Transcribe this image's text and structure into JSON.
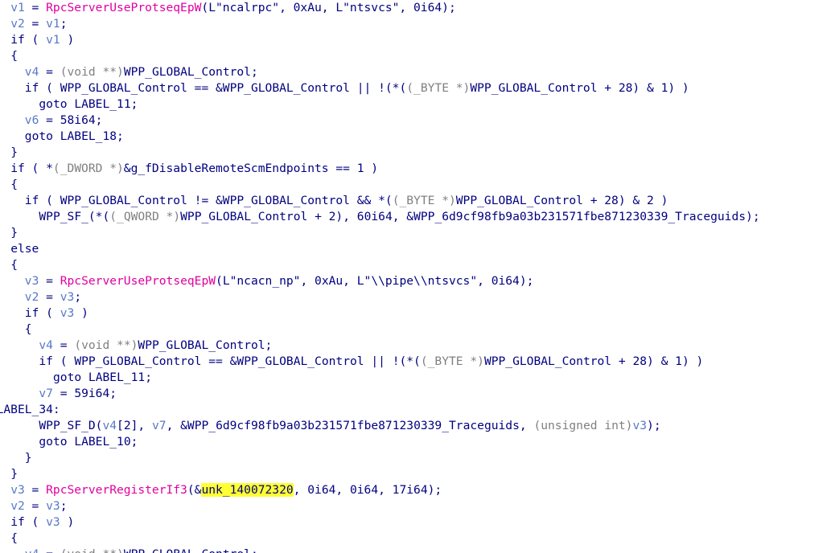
{
  "colors": {
    "default": "#000080",
    "var": "#5878c8",
    "func": "#e000a0",
    "cast": "#808080",
    "highlight": "#ffff33",
    "background": "#ffffff"
  },
  "lines": [
    {
      "indent": 1.5,
      "tokens": [
        [
          "v1",
          "var"
        ],
        [
          " = ",
          "default"
        ],
        [
          "RpcServerUseProtseqEpW",
          "func"
        ],
        [
          "(L\"ncalrpc\", 0xAu, L\"ntsvcs\", 0i64);",
          "default"
        ]
      ]
    },
    {
      "indent": 1.5,
      "tokens": [
        [
          "v2",
          "var"
        ],
        [
          " = ",
          "default"
        ],
        [
          "v1",
          "var"
        ],
        [
          ";",
          "default"
        ]
      ]
    },
    {
      "indent": 1.5,
      "tokens": [
        [
          "if ( ",
          "default"
        ],
        [
          "v1",
          "var"
        ],
        [
          " )",
          "default"
        ]
      ]
    },
    {
      "indent": 1.5,
      "tokens": [
        [
          "{",
          "default"
        ]
      ]
    },
    {
      "indent": 3.5,
      "tokens": [
        [
          "v4",
          "var"
        ],
        [
          " = ",
          "default"
        ],
        [
          "(void **)",
          "cast"
        ],
        [
          "WPP_GLOBAL_Control;",
          "default"
        ]
      ]
    },
    {
      "indent": 3.5,
      "tokens": [
        [
          "if ( WPP_GLOBAL_Control == &WPP_GLOBAL_Control || !(*(",
          "default"
        ],
        [
          "(_BYTE *)",
          "cast"
        ],
        [
          "WPP_GLOBAL_Control + 28) & 1) )",
          "default"
        ]
      ]
    },
    {
      "indent": 5.5,
      "tokens": [
        [
          "goto LABEL_11;",
          "default"
        ]
      ]
    },
    {
      "indent": 3.5,
      "tokens": [
        [
          "v6",
          "var"
        ],
        [
          " = 58i64;",
          "default"
        ]
      ]
    },
    {
      "indent": 3.5,
      "tokens": [
        [
          "goto LABEL_18;",
          "default"
        ]
      ]
    },
    {
      "indent": 1.5,
      "tokens": [
        [
          "}",
          "default"
        ]
      ]
    },
    {
      "indent": 1.5,
      "tokens": [
        [
          "if ( *",
          "default"
        ],
        [
          "(_DWORD *)",
          "cast"
        ],
        [
          "&g_fDisableRemoteScmEndpoints == 1 )",
          "default"
        ]
      ]
    },
    {
      "indent": 1.5,
      "tokens": [
        [
          "{",
          "default"
        ]
      ]
    },
    {
      "indent": 3.5,
      "tokens": [
        [
          "if ( WPP_GLOBAL_Control != &WPP_GLOBAL_Control && *(",
          "default"
        ],
        [
          "(_BYTE *)",
          "cast"
        ],
        [
          "WPP_GLOBAL_Control + 28) & 2 )",
          "default"
        ]
      ]
    },
    {
      "indent": 5.5,
      "tokens": [
        [
          "WPP_SF_(*(",
          "default"
        ],
        [
          "(_QWORD *)",
          "cast"
        ],
        [
          "WPP_GLOBAL_Control + 2), 60i64, &WPP_6d9cf98fb9a03b231571fbe871230339_Traceguids);",
          "default"
        ]
      ]
    },
    {
      "indent": 1.5,
      "tokens": [
        [
          "}",
          "default"
        ]
      ]
    },
    {
      "indent": 1.5,
      "tokens": [
        [
          "else",
          "default"
        ]
      ]
    },
    {
      "indent": 1.5,
      "tokens": [
        [
          "{",
          "default"
        ]
      ]
    },
    {
      "indent": 3.5,
      "tokens": [
        [
          "v3",
          "var"
        ],
        [
          " = ",
          "default"
        ],
        [
          "RpcServerUseProtseqEpW",
          "func"
        ],
        [
          "(L\"ncacn_np\", 0xAu, L\"\\\\pipe\\\\ntsvcs\", 0i64);",
          "default"
        ]
      ]
    },
    {
      "indent": 3.5,
      "tokens": [
        [
          "v2",
          "var"
        ],
        [
          " = ",
          "default"
        ],
        [
          "v3",
          "var"
        ],
        [
          ";",
          "default"
        ]
      ]
    },
    {
      "indent": 3.5,
      "tokens": [
        [
          "if ( ",
          "default"
        ],
        [
          "v3",
          "var"
        ],
        [
          " )",
          "default"
        ]
      ]
    },
    {
      "indent": 3.5,
      "tokens": [
        [
          "{",
          "default"
        ]
      ]
    },
    {
      "indent": 5.5,
      "tokens": [
        [
          "v4",
          "var"
        ],
        [
          " = ",
          "default"
        ],
        [
          "(void **)",
          "cast"
        ],
        [
          "WPP_GLOBAL_Control;",
          "default"
        ]
      ]
    },
    {
      "indent": 5.5,
      "tokens": [
        [
          "if ( WPP_GLOBAL_Control == &WPP_GLOBAL_Control || !(*(",
          "default"
        ],
        [
          "(_BYTE *)",
          "cast"
        ],
        [
          "WPP_GLOBAL_Control + 28) & 1) )",
          "default"
        ]
      ]
    },
    {
      "indent": 7.5,
      "tokens": [
        [
          "goto LABEL_11;",
          "default"
        ]
      ]
    },
    {
      "indent": 5.5,
      "tokens": [
        [
          "v7",
          "var"
        ],
        [
          " = 59i64;",
          "default"
        ]
      ]
    },
    {
      "indent": -0.5,
      "tokens": [
        [
          "LABEL_34:",
          "default"
        ]
      ]
    },
    {
      "indent": 5.5,
      "tokens": [
        [
          "WPP_SF_D(",
          "default"
        ],
        [
          "v4",
          "var"
        ],
        [
          "[2], ",
          "default"
        ],
        [
          "v7",
          "var"
        ],
        [
          ", &WPP_6d9cf98fb9a03b231571fbe871230339_Traceguids, ",
          "default"
        ],
        [
          "(unsigned int)",
          "cast"
        ],
        [
          "v3",
          "var"
        ],
        [
          ");",
          "default"
        ]
      ]
    },
    {
      "indent": 5.5,
      "tokens": [
        [
          "goto LABEL_10;",
          "default"
        ]
      ]
    },
    {
      "indent": 3.5,
      "tokens": [
        [
          "}",
          "default"
        ]
      ]
    },
    {
      "indent": 1.5,
      "tokens": [
        [
          "}",
          "default"
        ]
      ]
    },
    {
      "indent": 1.5,
      "tokens": [
        [
          "v3",
          "var"
        ],
        [
          " = ",
          "default"
        ],
        [
          "RpcServerRegisterIf3",
          "func"
        ],
        [
          "(&",
          "default"
        ],
        [
          "unk_140072320",
          "hl"
        ],
        [
          ", 0i64, 0i64, 17i64);",
          "default"
        ]
      ]
    },
    {
      "indent": 1.5,
      "tokens": [
        [
          "v2",
          "var"
        ],
        [
          " = ",
          "default"
        ],
        [
          "v3",
          "var"
        ],
        [
          ";",
          "default"
        ]
      ]
    },
    {
      "indent": 1.5,
      "tokens": [
        [
          "if ( ",
          "default"
        ],
        [
          "v3",
          "var"
        ],
        [
          " )",
          "default"
        ]
      ]
    },
    {
      "indent": 1.5,
      "tokens": [
        [
          "{",
          "default"
        ]
      ]
    },
    {
      "indent": 3.5,
      "tokens": [
        [
          "v4",
          "var"
        ],
        [
          " = ",
          "default"
        ],
        [
          "(void **)",
          "cast"
        ],
        [
          "WPP_GLOBAL_Control;",
          "default"
        ]
      ]
    }
  ]
}
